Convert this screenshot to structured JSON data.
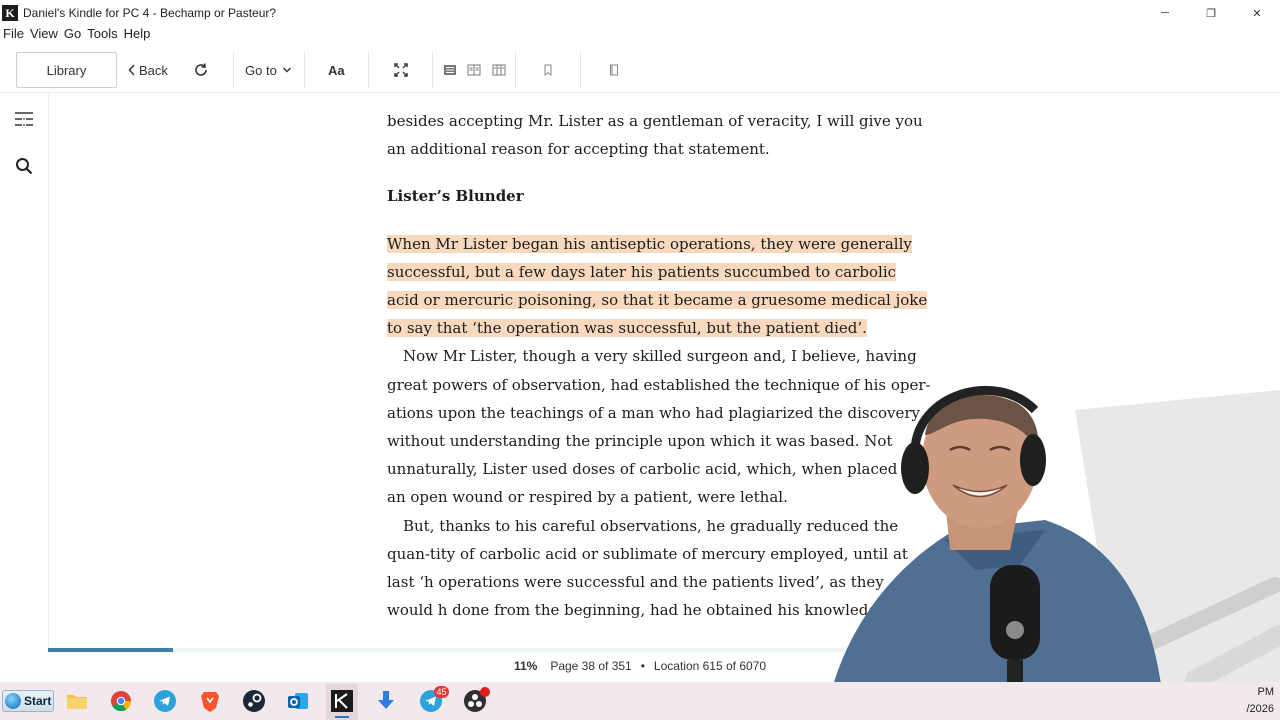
{
  "window": {
    "title": "Daniel's Kindle for PC 4 - Bechamp or Pasteur?",
    "minimize": "─",
    "maximize": "❐",
    "close": "✕"
  },
  "menu": [
    "File",
    "View",
    "Go",
    "Tools",
    "Help"
  ],
  "toolbar": {
    "library": "Library",
    "back": "Back",
    "goto": "Go to",
    "font": "Aa"
  },
  "icons": {
    "app": "kindle-app-icon",
    "back": "chevron-left-icon",
    "sync": "sync-icon",
    "goto_chevron": "chevron-down-icon",
    "fullscreen": "fullscreen-icon",
    "single_column": "single-column-icon",
    "two_column": "two-column-icon",
    "three_column": "three-column-icon",
    "bookmark": "bookmark-icon",
    "notebook": "notebook-icon",
    "toc": "table-of-contents-icon",
    "search": "search-icon"
  },
  "book": {
    "para_top": "besides accepting Mr. Lister as a gentleman of veracity, I will give you an additional reason for accepting that statement.",
    "heading": "Lister’s Blunder",
    "highlight": "When Mr Lister began his antiseptic operations, they were generally successful, but a few days later his patients succumbed to carbolic acid or mercuric poisoning, so that it became a gruesome medical joke to say that ‘the operation was successful, but the patient died’.",
    "para2": "Now Mr Lister, though a very skilled surgeon and, I believe, having great powers of observation, had established the technique of his oper-ations upon the teachings of a man who had plagiarized the discovery without understanding the principle upon which it was based. Not unnaturally, Lister used doses of carbolic acid, which, when placed u an open wound or respired by a patient, were lethal.",
    "para3": "But, thanks to his careful observations, he gradually reduced the quan-tity of carbolic acid or sublimate of mercury employed, until at last ‘h operations were successful and the patients lived’, as they would h done from the beginning, had he obtained his knowledge of th"
  },
  "status": {
    "percent": "11%",
    "page": "Page 38 of 351",
    "separator": "•",
    "location": "Location 615 of 6070",
    "progress_fraction": 0.11
  },
  "taskbar": {
    "start": "Start",
    "badge_count": "45",
    "clock_time": "PM",
    "clock_date": "/2026"
  },
  "colors": {
    "highlight": "#f9d9bd",
    "progress": "#3c7fa8",
    "taskbar": "#f2e9ee"
  }
}
